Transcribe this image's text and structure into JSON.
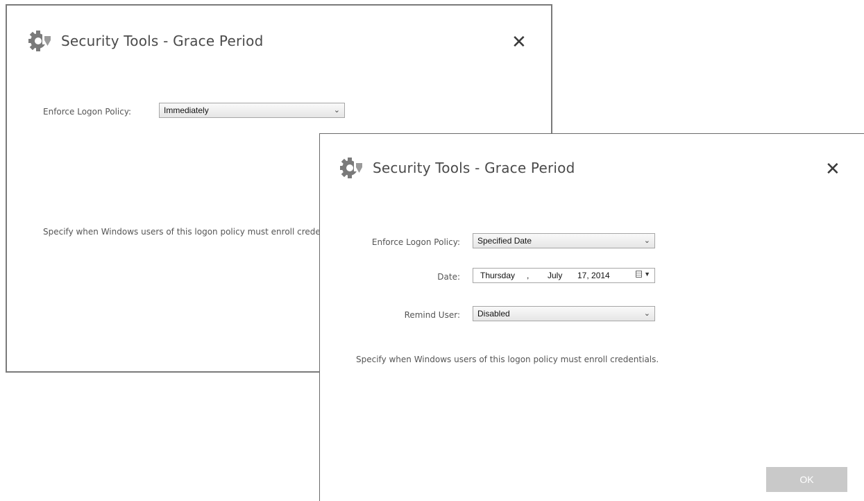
{
  "back_dialog": {
    "title": "Security Tools - Grace Period",
    "close_label": "✕",
    "enforce_label": "Enforce Logon Policy:",
    "enforce_value": "Immediately",
    "description": "Specify when Windows users of this logon policy must enroll credentials."
  },
  "front_dialog": {
    "title": "Security Tools - Grace Period",
    "close_label": "✕",
    "enforce_label": "Enforce Logon Policy:",
    "enforce_value": "Specified Date",
    "date_label": "Date:",
    "date": {
      "weekday": "Thursday",
      "separator": ",",
      "month": "July",
      "day_year": "17, 2014"
    },
    "remind_label": "Remind User:",
    "remind_value": "Disabled",
    "description": "Specify when Windows users of this logon policy must enroll credentials.",
    "ok_label": "OK"
  },
  "colors": {
    "ok_button": "#c9c9c9",
    "border": "#6f6f6f"
  }
}
